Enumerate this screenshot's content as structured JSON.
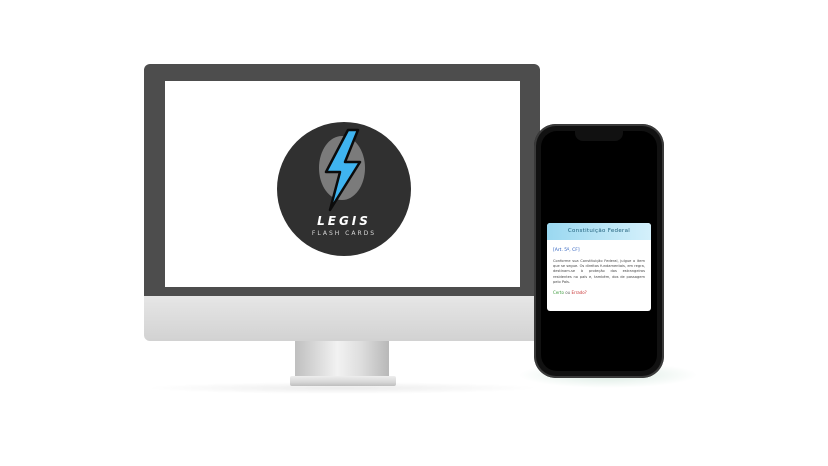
{
  "desktop": {
    "logo": {
      "title": "LEGIS",
      "subtitle": "FLASH CARDS",
      "bolt_color": "#3fb4f0",
      "circle_color": "#303030",
      "icon": "lightning-bolt-icon"
    }
  },
  "phone": {
    "card": {
      "header": "Constituição Federal",
      "reference": "[Art. 5º, CF]",
      "text": "Conforme sua Constituição Federal, julgue o item que se segue. Os direitos fundamentais, em regra, destinam-se à proteção dos estrangeiros residentes no país e, também, dos de passagem pelo País.",
      "answer_certo": "Certo",
      "answer_or": "ou",
      "answer_errado": "Errado?",
      "header_color": "#9ad8f0"
    }
  }
}
